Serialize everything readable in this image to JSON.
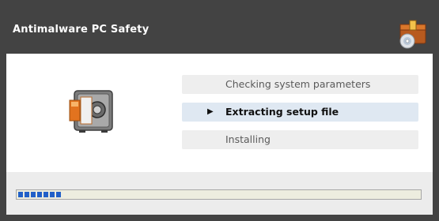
{
  "window": {
    "title": "Antimalware PC Safety",
    "title_icon": "package-disc-icon",
    "app_icon": "safe-icon"
  },
  "steps": [
    {
      "label": "Checking system parameters",
      "active": false
    },
    {
      "label": "Extracting setup file",
      "active": true
    },
    {
      "label": "Installing",
      "active": false
    }
  ],
  "progress": {
    "value": 0.1,
    "segments": 7
  },
  "colors": {
    "titlebar": "#434343",
    "active_step_bg": "#dfe8f2",
    "progress_segment": "#2160c8"
  }
}
